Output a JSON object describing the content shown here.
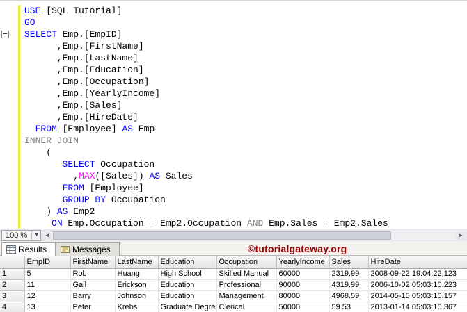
{
  "editor": {
    "zoom_label": "100 %",
    "lines": [
      {
        "tokens": [
          {
            "t": "USE",
            "c": "kw"
          },
          {
            "t": " [SQL Tutorial]",
            "c": "pl"
          }
        ]
      },
      {
        "tokens": [
          {
            "t": "GO",
            "c": "kw"
          }
        ]
      },
      {
        "collapse": true,
        "tokens": [
          {
            "t": "SELECT",
            "c": "kw"
          },
          {
            "t": " Emp.[EmpID]",
            "c": "pl"
          }
        ]
      },
      {
        "tokens": [
          {
            "t": "      ,Emp.[FirstName]",
            "c": "pl"
          }
        ]
      },
      {
        "tokens": [
          {
            "t": "      ,Emp.[LastName]",
            "c": "pl"
          }
        ]
      },
      {
        "tokens": [
          {
            "t": "      ,Emp.[Education]",
            "c": "pl"
          }
        ]
      },
      {
        "tokens": [
          {
            "t": "      ,Emp.[Occupation]",
            "c": "pl"
          }
        ]
      },
      {
        "tokens": [
          {
            "t": "      ,Emp.[YearlyIncome]",
            "c": "pl"
          }
        ]
      },
      {
        "tokens": [
          {
            "t": "      ,Emp.[Sales]",
            "c": "pl"
          }
        ]
      },
      {
        "tokens": [
          {
            "t": "      ,Emp.[HireDate]",
            "c": "pl"
          }
        ]
      },
      {
        "tokens": [
          {
            "t": "  ",
            "c": "pl"
          },
          {
            "t": "FROM",
            "c": "kw"
          },
          {
            "t": " [Employee] ",
            "c": "pl"
          },
          {
            "t": "AS",
            "c": "kw"
          },
          {
            "t": " Emp",
            "c": "pl"
          }
        ]
      },
      {
        "tokens": [
          {
            "t": "INNER JOIN",
            "c": "gy"
          }
        ]
      },
      {
        "tokens": [
          {
            "t": "    (",
            "c": "pl"
          }
        ]
      },
      {
        "tokens": [
          {
            "t": "       ",
            "c": "pl"
          },
          {
            "t": "SELECT",
            "c": "kw"
          },
          {
            "t": " Occupation",
            "c": "pl"
          }
        ]
      },
      {
        "tokens": [
          {
            "t": "         ,",
            "c": "pl"
          },
          {
            "t": "MAX",
            "c": "fn"
          },
          {
            "t": "([Sales]) ",
            "c": "pl"
          },
          {
            "t": "AS",
            "c": "kw"
          },
          {
            "t": " Sales",
            "c": "pl"
          }
        ]
      },
      {
        "tokens": [
          {
            "t": "       ",
            "c": "pl"
          },
          {
            "t": "FROM",
            "c": "kw"
          },
          {
            "t": " [Employee]",
            "c": "pl"
          }
        ]
      },
      {
        "tokens": [
          {
            "t": "       ",
            "c": "pl"
          },
          {
            "t": "GROUP BY",
            "c": "kw"
          },
          {
            "t": " Occupation",
            "c": "pl"
          }
        ]
      },
      {
        "tokens": [
          {
            "t": "    ) ",
            "c": "pl"
          },
          {
            "t": "AS",
            "c": "kw"
          },
          {
            "t": " Emp2",
            "c": "pl"
          }
        ]
      },
      {
        "tokens": [
          {
            "t": "     ",
            "c": "pl"
          },
          {
            "t": "ON",
            "c": "kw"
          },
          {
            "t": " Emp.Occupation ",
            "c": "pl"
          },
          {
            "t": "=",
            "c": "gy"
          },
          {
            "t": " Emp2.Occupation ",
            "c": "pl"
          },
          {
            "t": "AND",
            "c": "gy"
          },
          {
            "t": " Emp.Sales ",
            "c": "pl"
          },
          {
            "t": "=",
            "c": "gy"
          },
          {
            "t": " Emp2.Sales",
            "c": "pl"
          }
        ]
      }
    ]
  },
  "icons": {
    "collapse": "−",
    "zoom_dropdown": "▼",
    "scroll_left": "◄",
    "scroll_right": "►"
  },
  "results_panel": {
    "tabs": [
      {
        "label": "Results",
        "icon": "results-grid-icon",
        "active": true
      },
      {
        "label": "Messages",
        "icon": "messages-icon",
        "active": false
      }
    ],
    "watermark": "©tutorialgateway.org"
  },
  "grid": {
    "columns": [
      "EmpID",
      "FirstName",
      "LastName",
      "Education",
      "Occupation",
      "YearlyIncome",
      "Sales",
      "HireDate"
    ],
    "rows": [
      {
        "num": "1",
        "cells": [
          "5",
          "Rob",
          "Huang",
          "High School",
          "Skilled Manual",
          "60000",
          "2319.99",
          "2008-09-22 19:04:22.123"
        ]
      },
      {
        "num": "2",
        "cells": [
          "11",
          "Gail",
          "Erickson",
          "Education",
          "Professional",
          "90000",
          "4319.99",
          "2006-10-02 05:03:10.223"
        ]
      },
      {
        "num": "3",
        "cells": [
          "12",
          "Barry",
          "Johnson",
          "Education",
          "Management",
          "80000",
          "4968.59",
          "2014-05-15 05:03:10.157"
        ]
      },
      {
        "num": "4",
        "cells": [
          "13",
          "Peter",
          "Krebs",
          "Graduate Degree",
          "Clerical",
          "50000",
          "59.53",
          "2013-01-14 05:03:10.367"
        ]
      }
    ]
  },
  "colors": {
    "keyword": "#0000ff",
    "operator_gray": "#808080",
    "function_magenta": "#ff00ff",
    "identifier": "#000000",
    "change_bar_yellow": "#f1ee3c",
    "watermark_red": "#9c0000"
  }
}
